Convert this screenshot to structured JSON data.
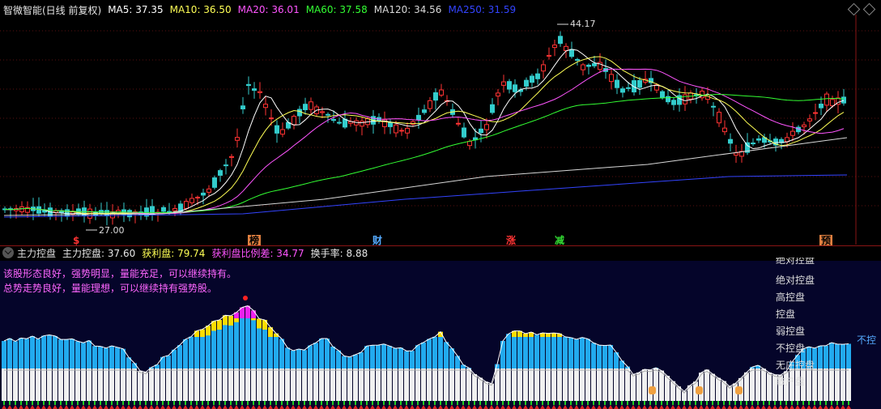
{
  "price_header": {
    "title": "智微智能(日线 前复权)",
    "ma": [
      {
        "label": "MA5: 37.35",
        "color": "#ffffff"
      },
      {
        "label": "MA10: 36.50",
        "color": "#ffff55"
      },
      {
        "label": "MA20: 36.01",
        "color": "#ff55ff"
      },
      {
        "label": "MA60: 37.58",
        "color": "#33ff33"
      },
      {
        "label": "MA120: 34.56",
        "color": "#d8d8d8"
      },
      {
        "label": "MA250: 31.59",
        "color": "#3344ff"
      }
    ]
  },
  "price_chart": {
    "high_label": "44.17",
    "low_label": "27.00",
    "events": [
      {
        "text": "$",
        "color": "#ff3333",
        "bg": "#000000"
      },
      {
        "text": "榜",
        "color": "#000000",
        "bg": "#e08040"
      },
      {
        "text": "财",
        "color": "#55aaff",
        "bg": "#000000"
      },
      {
        "text": "涨",
        "color": "#ff3333",
        "bg": "#000000"
      },
      {
        "text": "减",
        "color": "#33dd33",
        "bg": "#000000"
      },
      {
        "text": "预",
        "color": "#000000",
        "bg": "#e08040"
      }
    ],
    "colors": {
      "up": "#ff3333",
      "down": "#33cccc"
    }
  },
  "indicator_header": {
    "title": "主力控盘",
    "values": [
      {
        "label": "主力控盘: 37.60",
        "color": "#e6e6e6"
      },
      {
        "label": "获利盘: 79.74",
        "color": "#ffff55"
      },
      {
        "label": "获利盘比例差: 34.77",
        "color": "#ff55ff"
      },
      {
        "label": "换手率: 8.88",
        "color": "#e6e6e6"
      }
    ]
  },
  "indicator": {
    "messages": [
      {
        "text": "该股形态良好，强势明显，量能充足，可以继续持有。",
        "color": "#ff66ff"
      },
      {
        "text": "总势走势良好，量能理想，可以继续持有强势股。",
        "color": "#ff66ff"
      }
    ],
    "legend": [
      {
        "text": "绝对控盘",
        "color": "#ffff55"
      },
      {
        "text": "绝对控盘",
        "color": "#ffff55"
      },
      {
        "text": "高控盘",
        "color": "#ffff55"
      },
      {
        "text": "控盘",
        "color": "#ffff55"
      },
      {
        "text": "弱控盘",
        "color": "#ffff55"
      },
      {
        "text": "不控盘",
        "color": "#ffff55"
      },
      {
        "text": "无庄控盘",
        "color": "#ffff55"
      },
      {
        "text": "散户盘",
        "color": "#ffff55"
      }
    ],
    "right_label": "不控",
    "colors": {
      "blue": "#22aaee",
      "yellow": "#ffdd00",
      "magenta": "#ee22ee",
      "white": "#f0f0f0",
      "bg": "#05052a"
    }
  }
}
